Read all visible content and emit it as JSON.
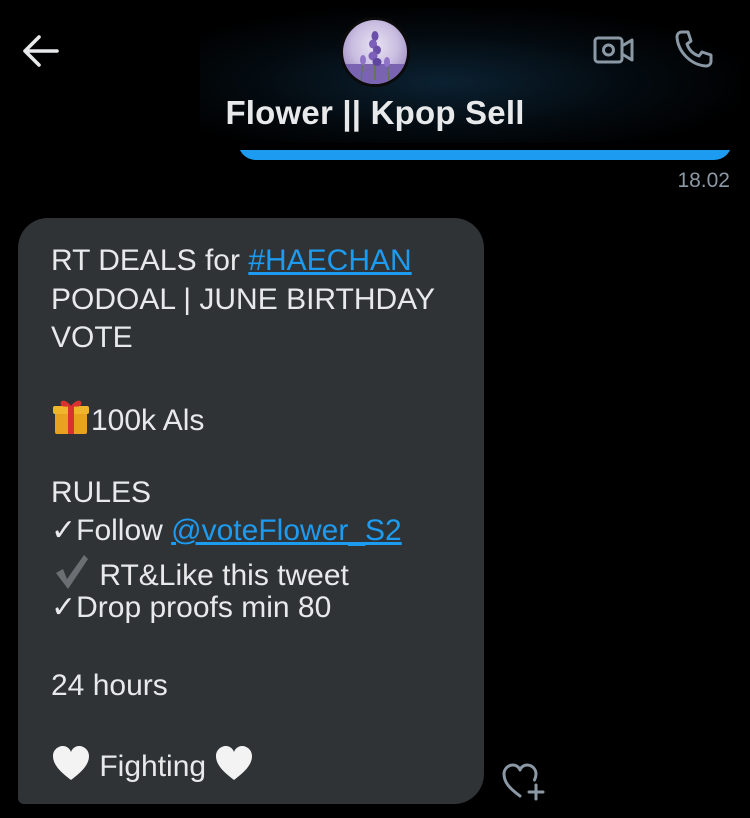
{
  "header": {
    "title": "Flower || Kpop Sell",
    "back_icon": "arrow-left-icon",
    "video_icon": "video-camera-icon",
    "call_icon": "phone-icon",
    "avatar_icon": "lavender-flower-avatar"
  },
  "conversation": {
    "sent_timestamp": "18.02",
    "received_message": {
      "line1_prefix": "RT DEALS for ",
      "line1_hashtag": "#HAECHAN",
      "line2": "PODOAL | JUNE BIRTHDAY",
      "line3": "VOTE",
      "prize": "100k Als",
      "rules_heading": "RULES",
      "rule1_prefix": "✓Follow ",
      "rule1_mention": "@voteFlower_S2",
      "rule2": " RT&Like this tweet",
      "rule3": "✓Drop proofs min 80",
      "duration": "24 hours",
      "closing": "Fighting"
    },
    "like_icon": "heart-plus-icon"
  },
  "colors": {
    "background": "#000000",
    "accent": "#1d9bf0",
    "bubble_received": "#2f3336",
    "text": "#e7e9ea",
    "muted": "#8b98a5"
  }
}
